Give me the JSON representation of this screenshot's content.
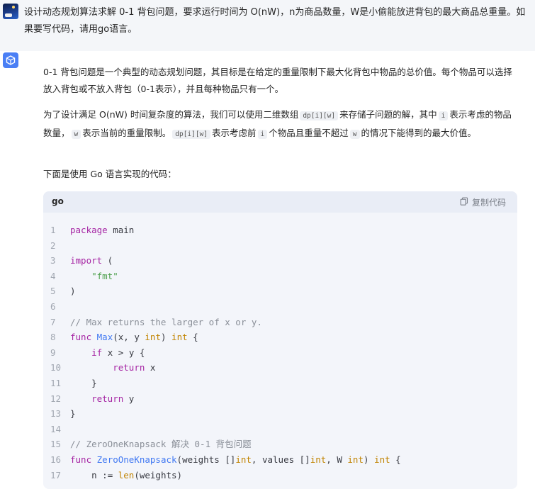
{
  "user_message": {
    "text": "设计动态规划算法求解 0-1 背包问题，要求运行时间为 O(nW)，n为商品数量，W是小偷能放进背包的最大商品总重量。如果要写代码，请用go语言。"
  },
  "answer": {
    "p1": "0-1 背包问题是一个典型的动态规划问题，其目标是在给定的重量限制下最大化背包中物品的总价值。每个物品可以选择放入背包或不放入背包（0-1表示），并且每种物品只有一个。",
    "p2": {
      "a": "为了设计满足 O(nW) 时间复杂度的算法，我们可以使用二维数组",
      "c1": "dp[i][w]",
      "b": "来存储子问题的解，其中",
      "c2": "i",
      "c": "表示考虑的物品数量，",
      "c3": "w",
      "d": "表示当前的重量限制。",
      "c4": "dp[i][w]",
      "e": "表示考虑前",
      "c5": "i",
      "f": "个物品且重量不超过",
      "c6": "w",
      "g": "的情况下能得到的最大价值。"
    },
    "p3": "下面是使用 Go 语言实现的代码："
  },
  "code": {
    "language": "go",
    "copy_label": "复制代码",
    "lines": [
      {
        "n": "1",
        "t": "package main"
      },
      {
        "n": "2",
        "t": ""
      },
      {
        "n": "3",
        "t": "import ("
      },
      {
        "n": "4",
        "t": "    \"fmt\""
      },
      {
        "n": "5",
        "t": ")"
      },
      {
        "n": "6",
        "t": ""
      },
      {
        "n": "7",
        "t": "// Max returns the larger of x or y."
      },
      {
        "n": "8",
        "t": "func Max(x, y int) int {"
      },
      {
        "n": "9",
        "t": "    if x > y {"
      },
      {
        "n": "10",
        "t": "        return x"
      },
      {
        "n": "11",
        "t": "    }"
      },
      {
        "n": "12",
        "t": "    return y"
      },
      {
        "n": "13",
        "t": "}"
      },
      {
        "n": "14",
        "t": ""
      },
      {
        "n": "15",
        "t": "// ZeroOneKnapsack 解决 0-1 背包问题"
      },
      {
        "n": "16",
        "t": "func ZeroOneKnapsack(weights []int, values []int, W int) int {"
      },
      {
        "n": "17",
        "t": "    n := len(weights)"
      }
    ]
  },
  "colors": {
    "keyword": "#a626a4",
    "function": "#4078f2",
    "string": "#50a14f",
    "comment": "#8a8f98",
    "type": "#c18401",
    "code_bg": "#f3f5fa",
    "user_bg": "#f4f6f9",
    "bot_avatar": "#4a7ff5"
  },
  "icons": {
    "user_avatar": "user-avatar",
    "bot_avatar": "cube-icon",
    "copy": "copy-icon"
  }
}
